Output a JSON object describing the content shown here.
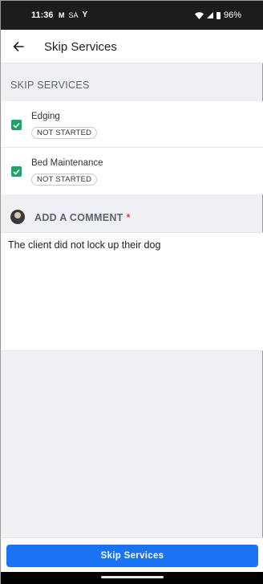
{
  "status_bar": {
    "time": "11:36",
    "left_indicators": [
      "M",
      "SA",
      "Y"
    ],
    "battery": "96%"
  },
  "app_bar": {
    "title": "Skip Services",
    "back_icon": "arrow-left-icon"
  },
  "skip_section": {
    "header": "SKIP SERVICES",
    "services": [
      {
        "name": "Edging",
        "status": "NOT STARTED",
        "checked": true
      },
      {
        "name": "Bed Maintenance",
        "status": "NOT STARTED",
        "checked": true
      }
    ]
  },
  "comment_section": {
    "title": "ADD A COMMENT",
    "required_marker": "*",
    "value": "The client did not lock up their dog"
  },
  "footer": {
    "button_label": "Skip Services"
  },
  "colors": {
    "accent": "#1a73f0",
    "checkbox": "#21a366",
    "required": "#e0463a"
  }
}
